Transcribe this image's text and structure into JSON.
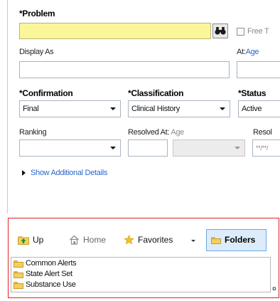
{
  "problem": {
    "label": "*Problem",
    "value": "",
    "free_text_label": "Free T"
  },
  "display_as": {
    "label": "Display As",
    "value": ""
  },
  "at_age": {
    "at_label": "At:",
    "age_link": "Age"
  },
  "confirmation": {
    "label": "*Confirmation",
    "selected": "Final"
  },
  "classification": {
    "label": "*Classification",
    "selected": "Clinical History"
  },
  "status": {
    "label": "*Status",
    "selected": "Active"
  },
  "ranking": {
    "label": "Ranking",
    "selected": ""
  },
  "resolved_at": {
    "label": "Resolved At:",
    "age_text": "Age",
    "value": "",
    "unit_selected": ""
  },
  "resolved_date": {
    "label": "Resol",
    "placeholder": "**/**/"
  },
  "show_more": {
    "label": "Show Additional Details"
  },
  "toolbar": {
    "up": "Up",
    "home": "Home",
    "favorites": "Favorites",
    "folders": "Folders"
  },
  "folders": [
    "Common Alerts",
    "State Alert Set",
    "Substance Use"
  ],
  "colors": {
    "required_field": "#fbf69a",
    "link": "#2b66c9",
    "panel_border": "#e0202a"
  }
}
